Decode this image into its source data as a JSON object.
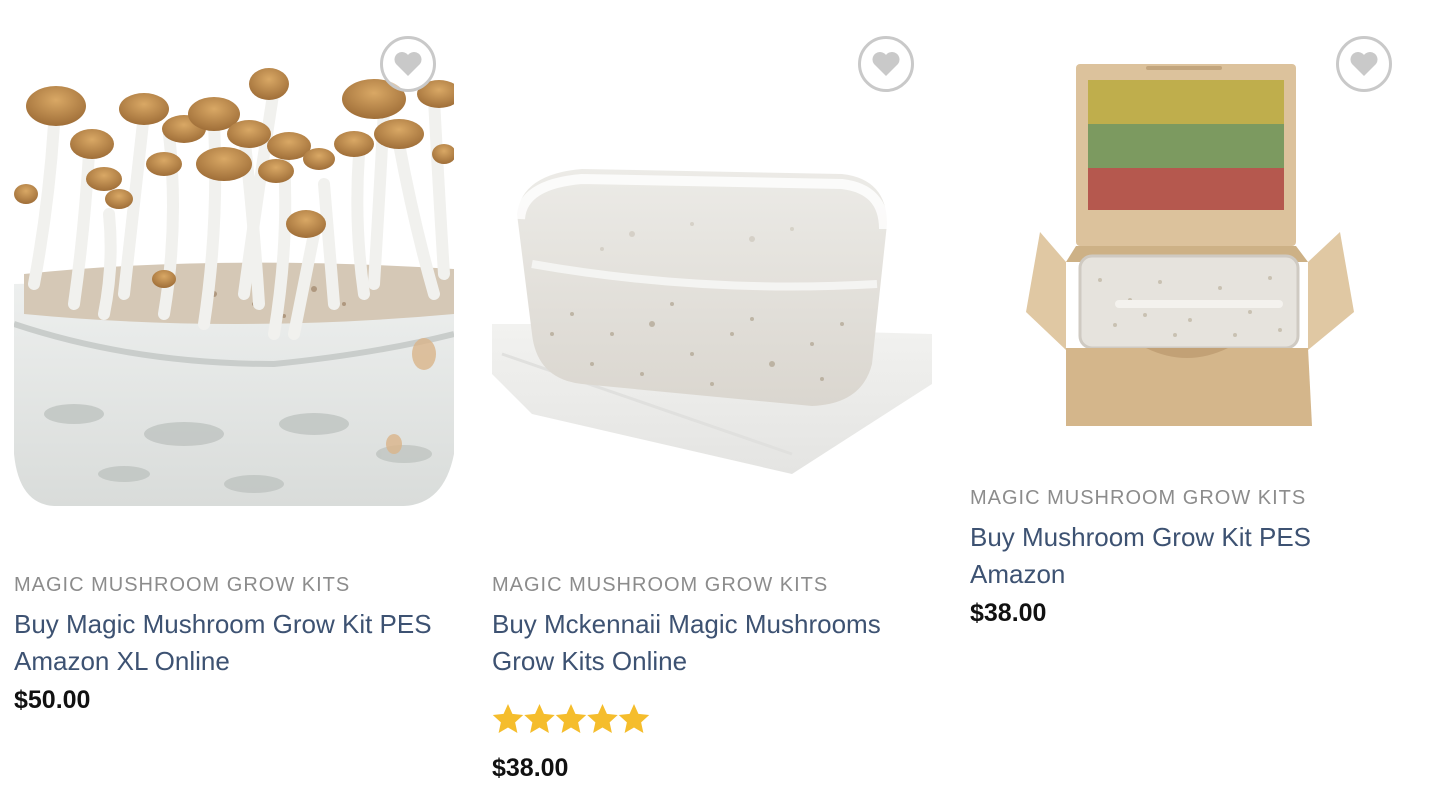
{
  "products": [
    {
      "category": "MAGIC MUSHROOM GROW KITS",
      "title": "Buy Magic Mushroom Grow Kit PES Amazon XL Online",
      "price": "$50.00",
      "image": "mushrooms-growing-in-tub",
      "wishlist_icon": "heart-icon"
    },
    {
      "category": "MAGIC MUSHROOM GROW KITS",
      "title": "Buy Mckennaii Magic Mushrooms Grow Kits Online",
      "price": "$38.00",
      "rating": 5,
      "rating_max": 5,
      "image": "grow-kit-tub",
      "wishlist_icon": "heart-icon"
    },
    {
      "category": "MAGIC MUSHROOM GROW KITS",
      "title": "Buy Mushroom Grow Kit PES Amazon",
      "price": "$38.00",
      "image": "grow-kit-in-box",
      "wishlist_icon": "heart-icon"
    }
  ],
  "colors": {
    "title": "#3d5272",
    "category": "#8c8c8c",
    "price": "#111111",
    "star": "#f5bd2c",
    "wishlist_border": "#c9c9c9"
  }
}
